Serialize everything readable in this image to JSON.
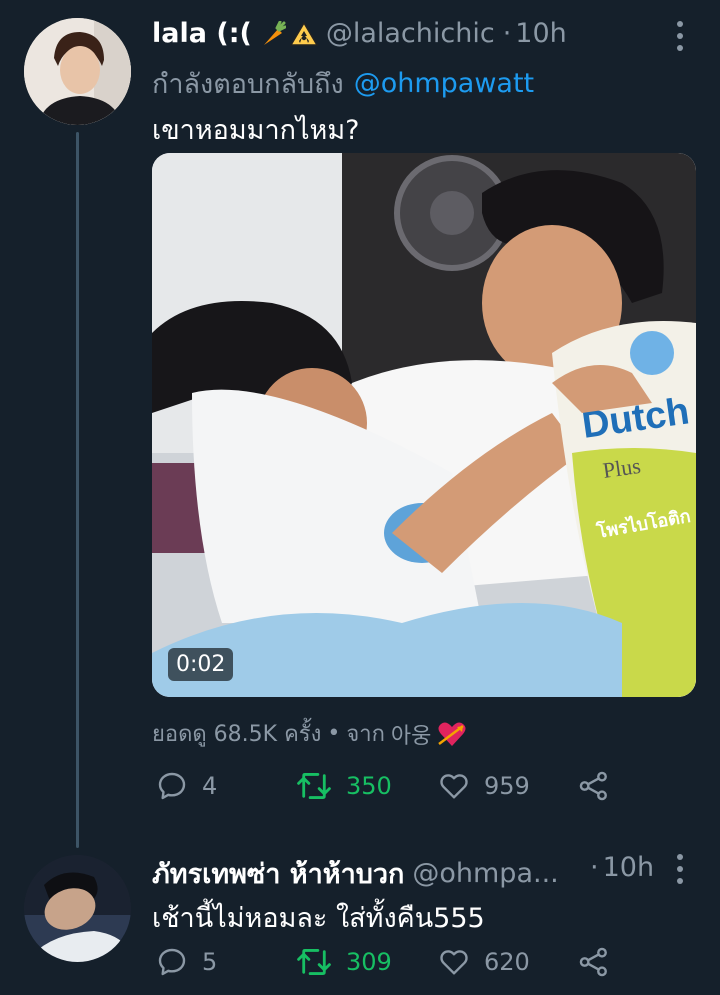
{
  "tweet1": {
    "display_name": "lala (:(",
    "emoji": "🥕⚠",
    "handle": "@lalachichic",
    "separator": "·",
    "time": "10h",
    "replying_prefix": "กำลังตอบกลับถึง",
    "replying_to": "@ohmpawatt",
    "text": "เขาหอมมากไหม?",
    "media": {
      "duration": "0:02",
      "pillow_brand": "Dutch",
      "pillow_sub": "Plus",
      "pillow_thai": "โพรไบโอติก"
    },
    "views": {
      "label": "ยอดดู 68.5K ครั้ง",
      "dot": "•",
      "source_prefix": "จาก",
      "source": "아웅"
    },
    "actions": {
      "reply_count": "4",
      "retweet_count": "350",
      "like_count": "959"
    }
  },
  "tweet2": {
    "display_name": "ภัทรเทพซ่า ห้าห้าบวก",
    "handle": "@ohmpa...",
    "separator": "·",
    "time": "10h",
    "text": "เช้านี้ไม่หอมละ ใส่ทั้งคืน555",
    "actions": {
      "reply_count": "5",
      "retweet_count": "309",
      "like_count": "620"
    }
  },
  "colors": {
    "background": "#15202b",
    "muted": "#8b98a5",
    "link": "#1d9bf0",
    "retweet_green": "#17bf63"
  },
  "icons": [
    "reply-icon",
    "retweet-icon",
    "like-icon",
    "share-icon",
    "more-icon"
  ]
}
